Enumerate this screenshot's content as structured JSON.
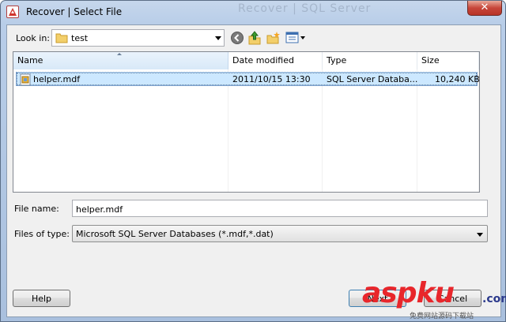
{
  "window": {
    "title": "Recover | Select File",
    "ghost_title": "Recover | SQL Server",
    "close_glyph": "✕"
  },
  "toolbar": {
    "lookin_label": "Look in:",
    "lookin_value": "test",
    "icons": [
      "back-icon",
      "up-folder-icon",
      "new-folder-icon",
      "view-menu-icon"
    ]
  },
  "list": {
    "columns": [
      "Name",
      "Date modified",
      "Type",
      "Size"
    ],
    "rows": [
      {
        "name": "helper.mdf",
        "date": "2011/10/15 13:30",
        "type": "SQL Server Databa...",
        "size": "10,240 KB"
      }
    ]
  },
  "fields": {
    "filename_label": "File name:",
    "filename_value": "helper.mdf",
    "filetype_label": "Files of type:",
    "filetype_value": "Microsoft SQL Server Databases (*.mdf,*.dat)"
  },
  "buttons": {
    "help": "Help",
    "next": "Next",
    "cancel": "Cancel"
  },
  "watermark": {
    "brand": "aspku",
    "dotcom": ".com",
    "sub": "免费网站源码下载站"
  }
}
